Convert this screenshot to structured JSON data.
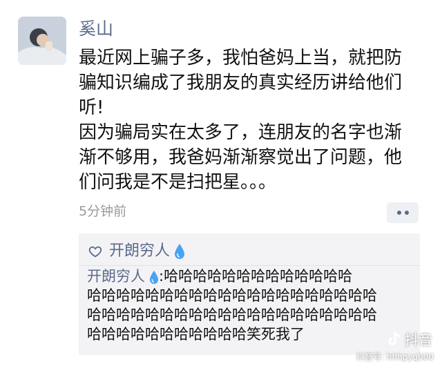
{
  "post": {
    "username": "奚山",
    "text_lines": [
      "最近网上骗子多，我怕爸妈上当，就把防",
      "骗知识编成了我朋友的真实经历讲给他们",
      "听!",
      "因为骗局实在太多了，连朋友的名字也渐",
      "渐不够用，我爸妈渐渐察觉出了问题，他",
      "们问我是不是扫把星。。。"
    ],
    "timestamp": "5分钟前"
  },
  "likes": {
    "names": "开朗穷人"
  },
  "comment": {
    "author": "开朗穷人",
    "separator": ":",
    "lines": [
      "哈哈哈哈哈哈哈哈哈哈哈哈哈",
      "哈哈哈哈哈哈哈哈哈哈哈哈哈哈哈哈哈哈哈哈",
      "哈哈哈哈哈哈哈哈哈哈哈哈哈哈哈哈哈哈哈哈",
      "哈哈哈哈哈哈哈哈哈哈哈笑死我了"
    ]
  },
  "watermark": {
    "brand": "抖音",
    "account": "抖音号: hhhpyq000"
  },
  "colors": {
    "link": "#5b6b8c",
    "text": "#111111",
    "muted": "#9a9a9a",
    "drop": "#4aa3f0"
  }
}
